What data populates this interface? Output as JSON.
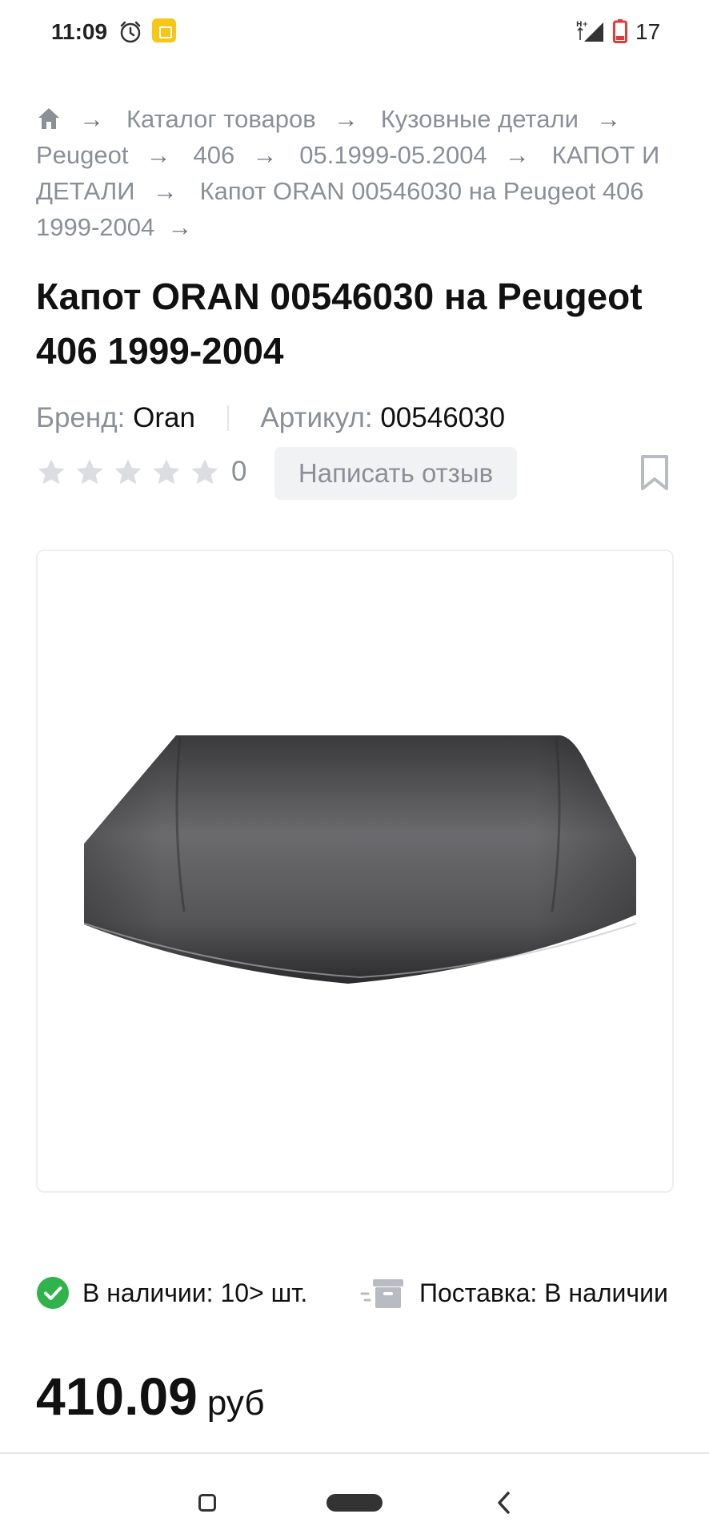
{
  "status_bar": {
    "time": "11:09",
    "battery_level": "17",
    "icons": [
      "alarm-icon",
      "app-notification-icon",
      "signal-icon",
      "battery-low-icon"
    ]
  },
  "breadcrumb": {
    "items": [
      {
        "label": "Каталог товаров"
      },
      {
        "label": "Кузовные детали"
      },
      {
        "label": "Peugeot"
      },
      {
        "label": "406"
      },
      {
        "label": "05.1999-05.2004"
      },
      {
        "label": "КАПОТ И ДЕТАЛИ"
      },
      {
        "label": "Капот ORAN 00546030 на Peugeot 406 1999-2004"
      }
    ],
    "separator": "→"
  },
  "product": {
    "title": "Капот ORAN 00546030 на Peugeot 406 1999-2004",
    "brand_label": "Бренд:",
    "brand_value": "Oran",
    "sku_label": "Артикул:",
    "sku_value": "00546030",
    "rating": {
      "stars_total": 5,
      "stars_filled": 0,
      "count": "0"
    },
    "review_button": "Написать отзыв",
    "image_alt": "car-hood-image"
  },
  "availability": {
    "stock_text": "В наличии: 10> шт.",
    "supply_text": "Поставка: В наличии"
  },
  "price": {
    "value": "410.09",
    "currency": "руб"
  },
  "colors": {
    "text": "#111111",
    "muted": "#8a8f98",
    "success": "#2fb34a",
    "button_bg": "#f1f2f4",
    "star": "#dcdde0"
  }
}
